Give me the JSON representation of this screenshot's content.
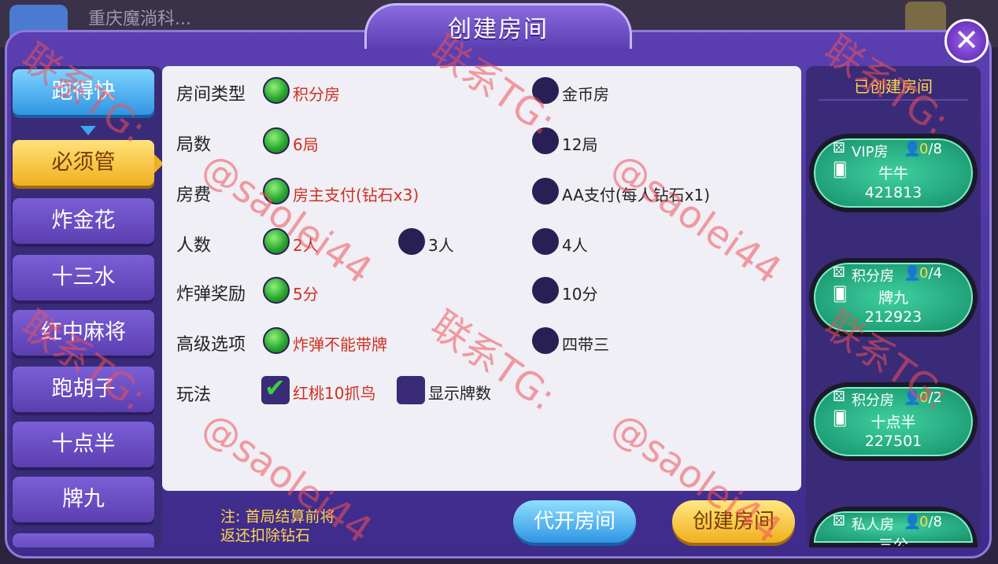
{
  "background": {
    "app_name": "重庆魔淌科..."
  },
  "dialog": {
    "title": "创建房间",
    "close_glyph": "✕"
  },
  "games": [
    {
      "label": "跑得快",
      "state": "blue"
    },
    {
      "label": "必须管",
      "state": "selected"
    },
    {
      "label": "炸金花",
      "state": "normal"
    },
    {
      "label": "十三水",
      "state": "normal"
    },
    {
      "label": "红中麻将",
      "state": "normal"
    },
    {
      "label": "跑胡子",
      "state": "normal"
    },
    {
      "label": "十点半",
      "state": "normal"
    },
    {
      "label": "牌九",
      "state": "normal"
    }
  ],
  "options": {
    "room_type": {
      "label": "房间类型",
      "choices": [
        "积分房",
        "金币房"
      ],
      "selected": "积分房"
    },
    "rounds": {
      "label": "局数",
      "choices": [
        "6局",
        "12局"
      ],
      "selected": "6局"
    },
    "fee": {
      "label": "房费",
      "choices": [
        "房主支付(钻石x3)",
        "AA支付(每人钻石x1)"
      ],
      "selected": "房主支付(钻石x3)"
    },
    "players": {
      "label": "人数",
      "choices": [
        "2人",
        "3人",
        "4人"
      ],
      "selected": "2人"
    },
    "bomb_reward": {
      "label": "炸弹奖励",
      "choices": [
        "5分",
        "10分"
      ],
      "selected": "5分"
    },
    "advanced": {
      "label": "高级选项",
      "choices": [
        "炸弹不能带牌",
        "四带三"
      ],
      "selected": "炸弹不能带牌"
    },
    "play": {
      "label": "玩法",
      "choices": [
        "红桃10抓鸟",
        "显示牌数"
      ],
      "checked": [
        "红桃10抓鸟"
      ]
    }
  },
  "note": {
    "line1": "注: 首局结算前将",
    "line2": "返还扣除钻石"
  },
  "buttons": {
    "proxy_open": "代开房间",
    "create": "创建房间"
  },
  "created_rooms": {
    "title": "已创建房间",
    "rooms": [
      {
        "type": "VIP房",
        "current": "0",
        "max": "/8",
        "game": "牛牛",
        "id": "421813"
      },
      {
        "type": "积分房",
        "current": "0",
        "max": "/4",
        "game": "牌九",
        "id": "212923"
      },
      {
        "type": "积分房",
        "current": "0",
        "max": "/2",
        "game": "十点半",
        "id": "227501"
      },
      {
        "type": "私人房",
        "current": "0",
        "max": "/8",
        "game": "三公",
        "id": ""
      }
    ]
  },
  "watermark": {
    "contact": "联系TG:",
    "handle": "@saolei44"
  },
  "colors": {
    "dialog": "#5b3fb1",
    "selected_text": "#d03020",
    "note": "#ffd84a",
    "room_card": "#16906a"
  }
}
